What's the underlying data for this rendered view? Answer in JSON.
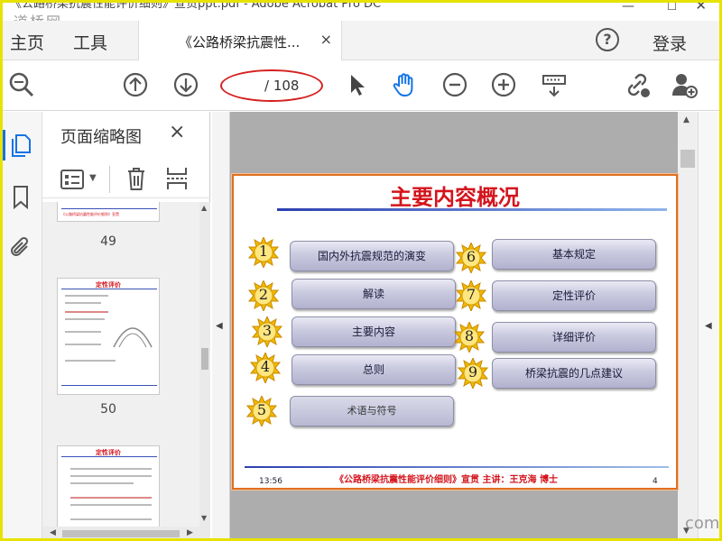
{
  "titlebar": {
    "title": "《公路桥梁抗震性能评价细则》宣贯ppt.pdf - Adobe Acrobat Pro DC",
    "watermark": "道桥网"
  },
  "menu": {
    "home": "主页",
    "tools": "工具",
    "login": "登录",
    "help": "?"
  },
  "tab": {
    "title": "《公路桥梁抗震性...",
    "close": "×"
  },
  "toolbar": {
    "page_value": "",
    "page_total": "/ 108"
  },
  "panel": {
    "title": "页面缩略图",
    "close": "×",
    "thumbnails": [
      {
        "number": "49",
        "header": "《公路桥梁抗震性能评价细则》宣贯"
      },
      {
        "number": "50",
        "title": "定性评价"
      },
      {
        "number": "",
        "title": "定性评价"
      }
    ]
  },
  "slide": {
    "title": "主要内容概况",
    "items": [
      {
        "num": "1",
        "label": "国内外抗震规范的演变"
      },
      {
        "num": "2",
        "label": "解读"
      },
      {
        "num": "3",
        "label": "主要内容"
      },
      {
        "num": "4",
        "label": "总则"
      },
      {
        "num": "5",
        "label": "术语与符号"
      },
      {
        "num": "6",
        "label": "基本规定"
      },
      {
        "num": "7",
        "label": "定性评价"
      },
      {
        "num": "8",
        "label": "详细评价"
      },
      {
        "num": "9",
        "label": "桥梁抗震的几点建议"
      }
    ],
    "footer_time": "13:56",
    "footer_title": "《公路桥梁抗震性能评价细则》宣贯    主讲：王克海 博士",
    "footer_page": "4"
  },
  "watermark_br": "com",
  "colors": {
    "accent": "#1473e6",
    "slide_title": "#d4141c",
    "highlight": "#d62020"
  }
}
